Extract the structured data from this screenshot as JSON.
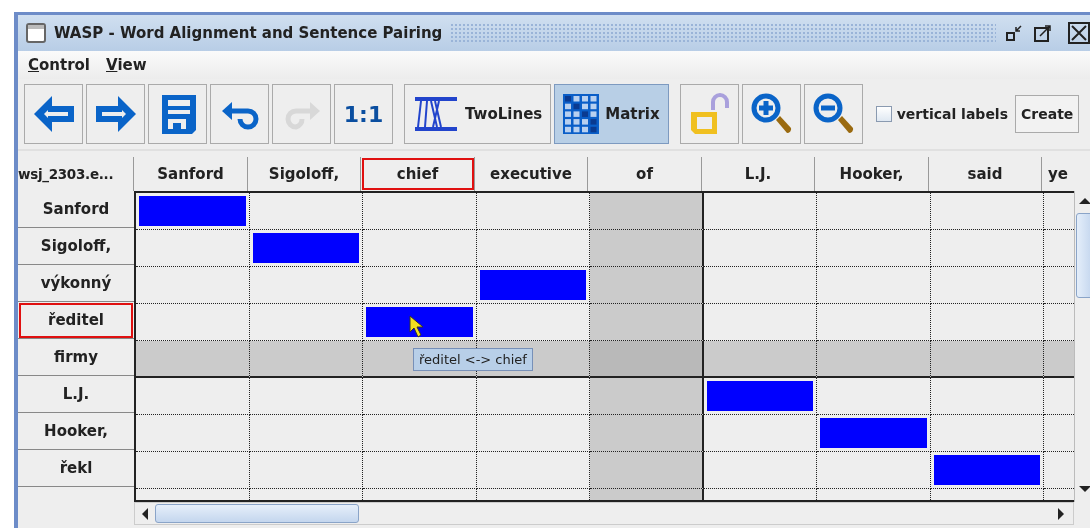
{
  "window": {
    "title": "WASP - Word Alignment and Sentence Pairing"
  },
  "menu": [
    {
      "label": "Control"
    },
    {
      "label": "View"
    }
  ],
  "toolbar": [
    {
      "kind": "back",
      "disabled": false,
      "selected": false
    },
    {
      "kind": "forward",
      "disabled": false,
      "selected": false
    },
    {
      "kind": "save",
      "disabled": false,
      "selected": false
    },
    {
      "kind": "undo",
      "disabled": false,
      "selected": false
    },
    {
      "kind": "redo",
      "disabled": true,
      "selected": false
    },
    {
      "kind": "text",
      "label": "1:1",
      "disabled": false,
      "selected": false
    },
    {
      "kind": "twolines",
      "label": "TwoLines",
      "disabled": false,
      "selected": false
    },
    {
      "kind": "matrix",
      "label": "Matrix",
      "disabled": false,
      "selected": true
    },
    {
      "kind": "lock",
      "disabled": false,
      "selected": false
    },
    {
      "kind": "zoom-in",
      "disabled": false,
      "selected": false
    },
    {
      "kind": "zoom-out",
      "disabled": false,
      "selected": false
    }
  ],
  "vertical_labels": {
    "label": "vertical labels",
    "checked": false
  },
  "create_button": "Create",
  "matrix": {
    "corner": "wsj_2303.e...",
    "columns": [
      {
        "label": "Sanford",
        "selected": false,
        "highlighted": false
      },
      {
        "label": "Sigoloff,",
        "selected": false,
        "highlighted": false
      },
      {
        "label": "chief",
        "selected": true,
        "highlighted": false
      },
      {
        "label": "executive",
        "selected": false,
        "highlighted": false
      },
      {
        "label": "of",
        "selected": false,
        "highlighted": true
      },
      {
        "label": "L.J.",
        "selected": false,
        "highlighted": false
      },
      {
        "label": "Hooker,",
        "selected": false,
        "highlighted": false
      },
      {
        "label": "said",
        "selected": false,
        "highlighted": false
      },
      {
        "label": "ye",
        "selected": false,
        "highlighted": false
      }
    ],
    "rows": [
      {
        "label": "Sanford",
        "selected": false,
        "highlighted": false,
        "aligned": [
          true,
          false,
          false,
          false,
          false,
          false,
          false,
          false,
          false
        ]
      },
      {
        "label": "Sigoloff,",
        "selected": false,
        "highlighted": false,
        "aligned": [
          false,
          true,
          false,
          false,
          false,
          false,
          false,
          false,
          false
        ]
      },
      {
        "label": "výkonný",
        "selected": false,
        "highlighted": false,
        "aligned": [
          false,
          false,
          false,
          true,
          false,
          false,
          false,
          false,
          false
        ]
      },
      {
        "label": "ředitel",
        "selected": true,
        "highlighted": false,
        "aligned": [
          false,
          false,
          true,
          false,
          false,
          false,
          false,
          false,
          false
        ]
      },
      {
        "label": "firmy",
        "selected": false,
        "highlighted": true,
        "aligned": [
          false,
          false,
          false,
          false,
          false,
          false,
          false,
          false,
          false
        ]
      },
      {
        "label": "L.J.",
        "selected": false,
        "highlighted": false,
        "aligned": [
          false,
          false,
          false,
          false,
          false,
          true,
          false,
          false,
          false
        ]
      },
      {
        "label": "Hooker,",
        "selected": false,
        "highlighted": false,
        "aligned": [
          false,
          false,
          false,
          false,
          false,
          false,
          true,
          false,
          false
        ]
      },
      {
        "label": "řekl",
        "selected": false,
        "highlighted": false,
        "aligned": [
          false,
          false,
          false,
          false,
          false,
          false,
          false,
          true,
          false
        ]
      }
    ],
    "tooltip": "ředitel <-> chief"
  }
}
